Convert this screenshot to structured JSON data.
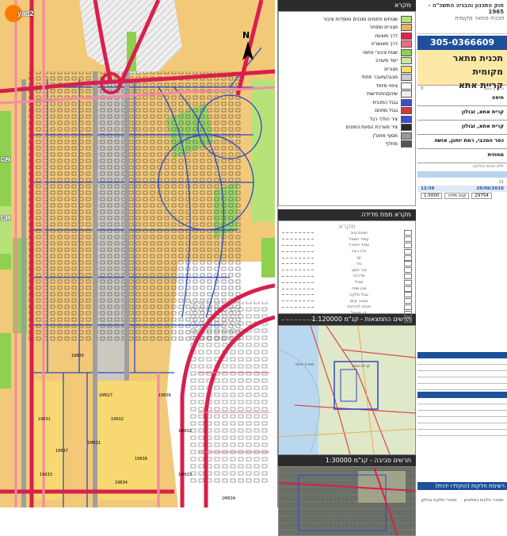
{
  "watermark": {
    "brand": "yad2"
  },
  "map": {
    "north_label": "N",
    "zone_codes": [
      "452",
      "451",
      "19631",
      "19632",
      "19633",
      "19634",
      "19635",
      "19636",
      "19637",
      "19638",
      "1M627",
      "1M631",
      "1M632",
      "1M633",
      "1M634"
    ]
  },
  "legend": {
    "title": "מקרא",
    "items": [
      {
        "label": "שטחים פתוחים ומבנים ומוסדות ציבור",
        "color": "#b7e27a"
      },
      {
        "label": "מגורים ומסחר",
        "color": "#e9b45f"
      },
      {
        "label": "דרך מוצעת",
        "color": "#e2224f"
      },
      {
        "label": "דרך מאושרת",
        "color": "#f26a8a"
      },
      {
        "label": "שטח ציבורי פתוח",
        "color": "#8fd14f"
      },
      {
        "label": "יעוד מעורב",
        "color": "#c9e6a0"
      },
      {
        "label": "מגורים",
        "color": "#f7dc6f"
      },
      {
        "label": "מבנה/מעבר תחתי",
        "color": "#cccccc"
      },
      {
        "label": "ציפוי מיוחד",
        "color": "#ffffff"
      },
      {
        "label": "שיכון/התחדשות",
        "color": "#eeeeee"
      },
      {
        "label": "גבול התכנית",
        "color": "#3a4fd4"
      },
      {
        "label": "גבול מתחם",
        "color": "#d43a3a"
      },
      {
        "label": "ציר הולכי רגל",
        "color": "#3a4fd4"
      },
      {
        "label": "ציר מערכת הסעת המונים",
        "color": "#2a2a2a"
      },
      {
        "label": "מסוף מתע\"ן",
        "color": "#999999"
      },
      {
        "label": "מחלף",
        "color": "#555555"
      }
    ]
  },
  "measure_legend": {
    "title": "מקרא מפת מדידה",
    "watermark": "מקרא",
    "rows": [
      "שוחת ביוב",
      "עמוד חשמל",
      "עמוד תאורה",
      "ברז כיבוי",
      "עץ",
      "גדר",
      "קיר תומך",
      "מדרכה",
      "שביל",
      "אבן שפה",
      "גבול חלקה",
      "מבנה קיים",
      "מבנה להריסה",
      "קו חשמל",
      "קו מים"
    ]
  },
  "inset_location": {
    "title": "תרשים התמצאות - קנ\"מ 1:120000",
    "labels": [
      "מפרץ חיפה",
      "קריית אתא"
    ]
  },
  "inset_surroundings": {
    "title": "תרשים סביבה - קנ\"מ 1:30000"
  },
  "info": {
    "law_line": "חוק התכנון והבניה התשכ\"ה - 1965",
    "law_sub": "תכנית מתאר מקומית",
    "plan_number": "305-0366609",
    "plan_name_1": "תכנית מתאר מקומית",
    "plan_name_2": "קריית אתא",
    "version": "גליון 2 מתוך",
    "version_num": "8",
    "district": "חיפה",
    "local_committee": "קרית אתא, זבולון",
    "authorities": "קרית אתא, זבולון",
    "localities": "כפר המכבי, רמת יוחנן, אושה",
    "type": "מחוזית",
    "type_sub": "ללא איחוד וחלוקה",
    "version_code": "11",
    "time": "12:59",
    "date": "29/06/2016",
    "scale_label": "קנה מידה",
    "scale_value": "1:5000",
    "sheet_no": "29754",
    "bottom_title": "רשימת חלקות (הוקלדו ידנית)",
    "bottom_cols": [
      "מספרי חלקות בשלמותן",
      "מספרי חלקות בחלקן"
    ]
  }
}
